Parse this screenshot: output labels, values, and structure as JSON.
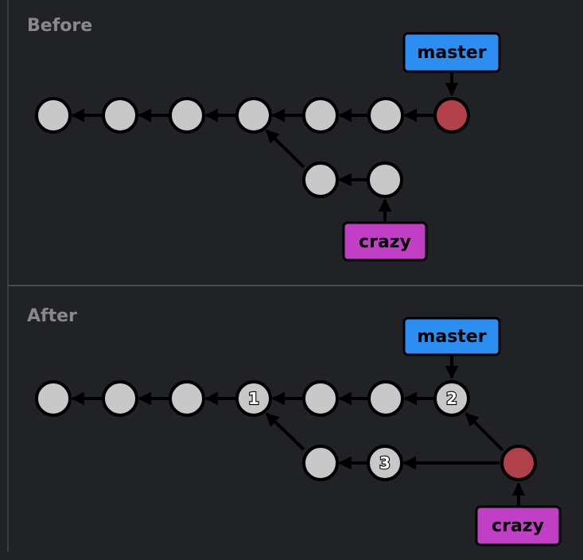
{
  "before": {
    "title": "Before",
    "labels": {
      "master": "master",
      "crazy": "crazy"
    }
  },
  "after": {
    "title": "After",
    "labels": {
      "master": "master",
      "crazy": "crazy"
    },
    "commit_numbers": {
      "c1": "1",
      "c2": "2",
      "c3": "3"
    }
  },
  "colors": {
    "background": "#212226",
    "commit_fill": "#c8c8c8",
    "head_commit_fill": "#b0404a",
    "master_label": "#2b8ef0",
    "crazy_label": "#c13fc4",
    "outline": "#000000"
  }
}
